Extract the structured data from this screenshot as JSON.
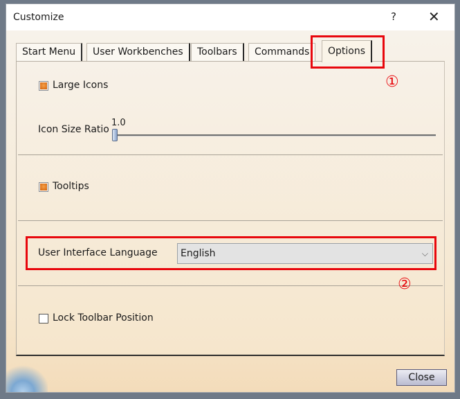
{
  "window": {
    "title": "Customize",
    "help_label": "?",
    "close_glyph": "✕"
  },
  "tabs": [
    {
      "label": "Start Menu",
      "active": false
    },
    {
      "label": "User Workbenches",
      "active": false
    },
    {
      "label": "Toolbars",
      "active": false
    },
    {
      "label": "Commands",
      "active": false
    },
    {
      "label": "Options",
      "active": true
    }
  ],
  "options": {
    "large_icons": {
      "label": "Large Icons",
      "checked": true
    },
    "icon_size_ratio": {
      "label": "Icon Size Ratio",
      "value": "1.0"
    },
    "tooltips": {
      "label": "Tooltips",
      "checked": true
    },
    "language": {
      "label": "User Interface Language",
      "selected": "English"
    },
    "lock_toolbar": {
      "label": "Lock Toolbar Position",
      "checked": false
    }
  },
  "annotations": {
    "marker_1": "①",
    "marker_2": "②",
    "highlight_color": "#e8070d"
  },
  "footer": {
    "close_label": "Close"
  },
  "icons": {
    "chevron": "⌵"
  }
}
